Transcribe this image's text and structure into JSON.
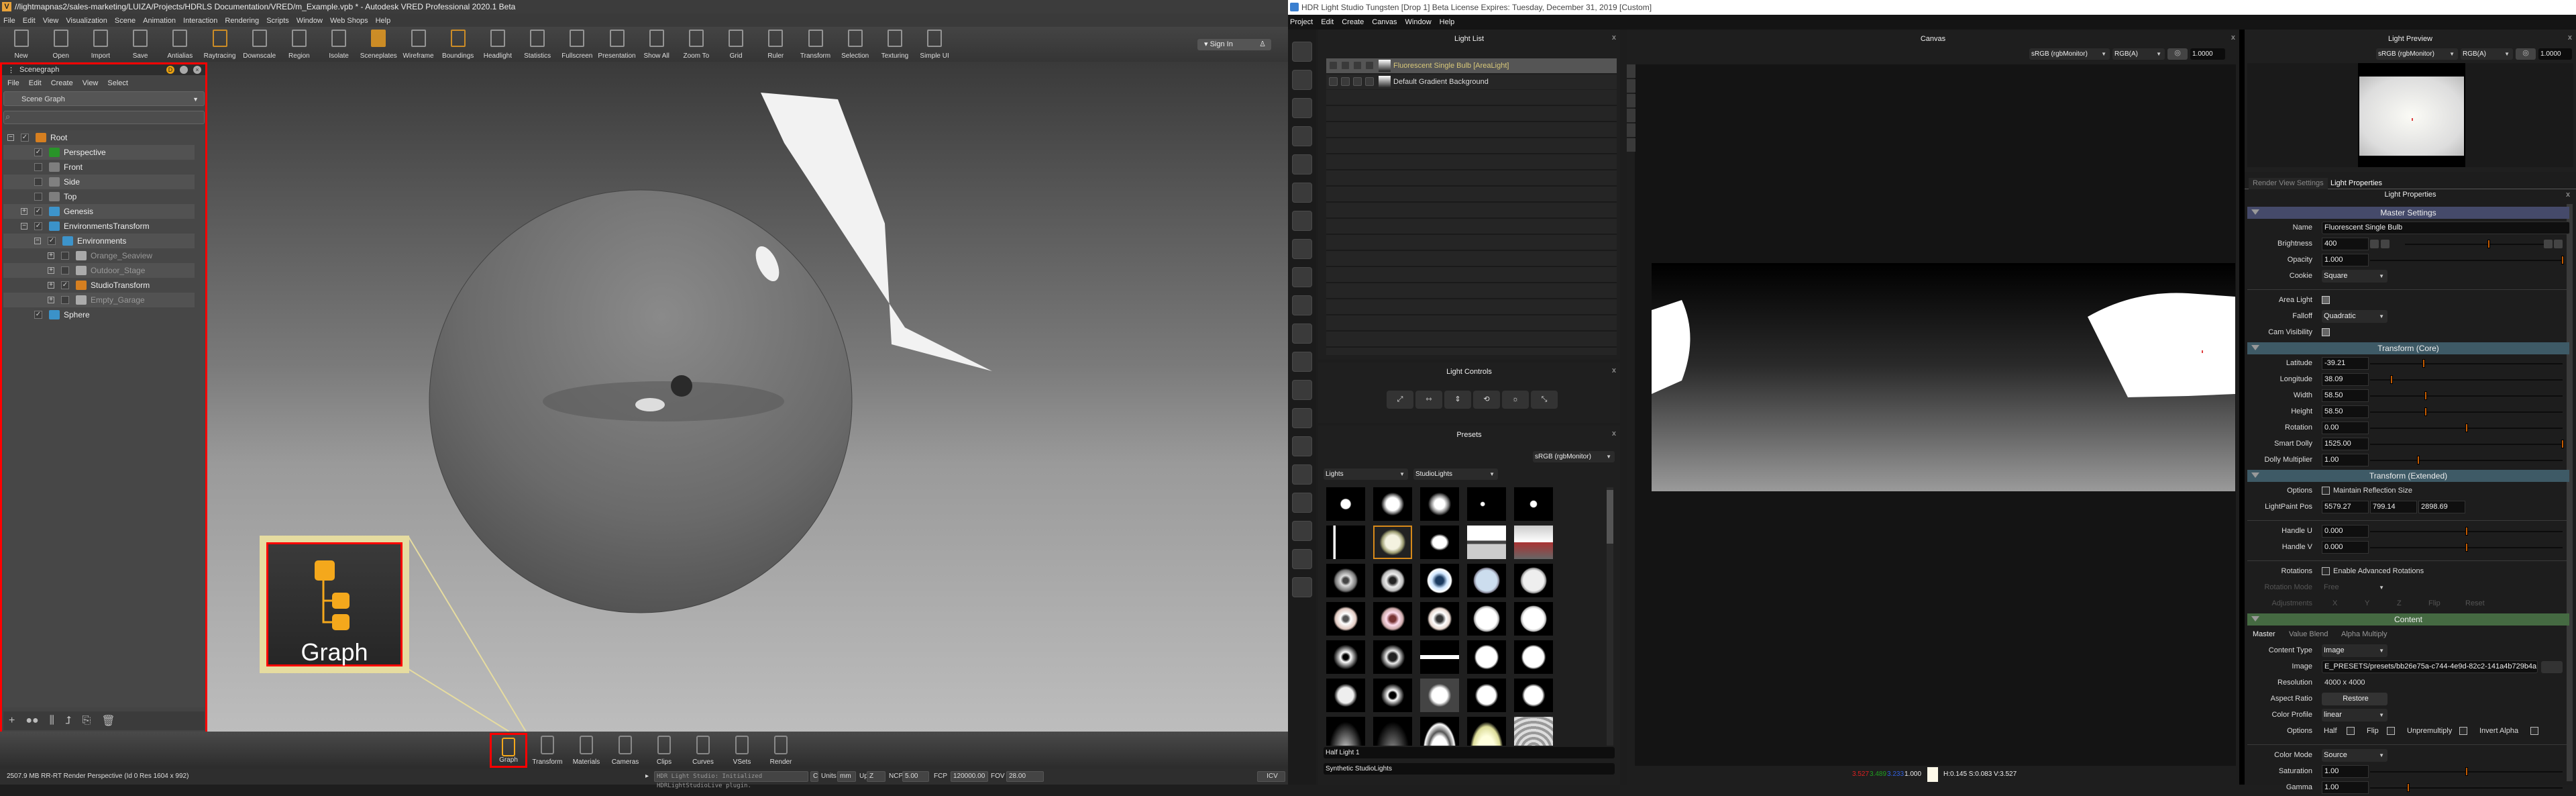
{
  "vred": {
    "title": "//lightmapnas2/sales-marketing/LUIZA/Projects/HDRLS Documentation/VRED/m_Example.vpb * - Autodesk VRED Professional 2020.1 Beta",
    "menu": [
      "File",
      "Edit",
      "View",
      "Visualization",
      "Scene",
      "Animation",
      "Interaction",
      "Rendering",
      "Scripts",
      "Window",
      "Web Shops",
      "Help"
    ],
    "toolbar": [
      "New",
      "Open",
      "Import",
      "Save",
      "Antialias",
      "Raytracing",
      "Downscale",
      "Region",
      "Isolate",
      "Sceneplates",
      "Wireframe",
      "Boundings",
      "Headlight",
      "Statistics",
      "Fullscreen",
      "Presentation",
      "Show All",
      "Zoom To",
      "Grid",
      "Ruler",
      "Transform",
      "Selection",
      "Texturing",
      "Simple UI"
    ],
    "sign_in": "Sign In",
    "scenegraph": {
      "title": "Scenegraph",
      "menu": [
        "File",
        "Edit",
        "Create",
        "View",
        "Select"
      ],
      "view_select": "Scene Graph",
      "search_placeholder": "",
      "tree": [
        {
          "label": "Root",
          "level": 0,
          "expander": "-",
          "checked": true,
          "icon": "transform-node-icon"
        },
        {
          "label": "Perspective",
          "level": 1,
          "expander": "",
          "checked": true,
          "icon": "camera-icon"
        },
        {
          "label": "Front",
          "level": 1,
          "expander": "",
          "checked": false,
          "icon": "cube-icon"
        },
        {
          "label": "Side",
          "level": 1,
          "expander": "",
          "checked": false,
          "icon": "cube-icon"
        },
        {
          "label": "Top",
          "level": 1,
          "expander": "",
          "checked": false,
          "icon": "cube-icon"
        },
        {
          "label": "Genesis",
          "level": 1,
          "expander": "+",
          "checked": true,
          "icon": "transform-icon"
        },
        {
          "label": "EnvironmentsTransform",
          "level": 1,
          "expander": "-",
          "checked": true,
          "icon": "transform-icon"
        },
        {
          "label": "Environments",
          "level": 2,
          "expander": "-",
          "checked": true,
          "icon": "environment-switch-icon"
        },
        {
          "label": "Orange_Seaview",
          "level": 3,
          "expander": "+",
          "checked": false,
          "icon": "environment-icon",
          "dimmed": true
        },
        {
          "label": "Outdoor_Stage",
          "level": 3,
          "expander": "+",
          "checked": false,
          "icon": "environment-icon",
          "dimmed": true
        },
        {
          "label": "StudioTransform",
          "level": 3,
          "expander": "+",
          "checked": true,
          "icon": "transform-node-icon"
        },
        {
          "label": "Empty_Garage",
          "level": 3,
          "expander": "+",
          "checked": false,
          "icon": "environment-icon",
          "dimmed": true
        },
        {
          "label": "Sphere",
          "level": 1,
          "expander": "",
          "checked": true,
          "icon": "geometry-icon"
        }
      ]
    },
    "callout_label": "Graph",
    "modules": [
      "Graph",
      "Transform",
      "Materials",
      "Cameras",
      "Clips",
      "Curves",
      "VSets",
      "Render"
    ],
    "status": {
      "text": "2507.9 MB  RR-RT  Render Perspective (Id 0 Res 1604 x 992)",
      "console": "HDR Light Studio: Initialized HDRLightStudioLive plugin.",
      "c_button": "C",
      "units_label": "Units",
      "units": "mm",
      "up_label": "Up",
      "up": "Z",
      "ncp_label": "NCP",
      "ncp": "5.00",
      "fcp_label": "FCP",
      "fcp": "120000.00",
      "fov_label": "FOV",
      "fov": "28.00",
      "icv": "ICV"
    }
  },
  "hdr": {
    "title": "HDR Light Studio Tungsten [Drop 1] Beta License Expires: Tuesday, December 31, 2019  [Custom]",
    "menu": [
      "Project",
      "Edit",
      "Create",
      "Canvas",
      "Window",
      "Help"
    ],
    "light_list": {
      "title": "Light List",
      "items": [
        {
          "label": "Fluorescent Single Bulb [AreaLight]",
          "selected": true
        },
        {
          "label": "Default Gradient Background",
          "selected": false
        }
      ]
    },
    "light_controls": {
      "title": "Light Controls"
    },
    "presets": {
      "title": "Presets",
      "color_space": "sRGB (rgbMonitor)",
      "category": "Lights",
      "subcategory": "StudioLights",
      "selected_name": "Half Light 1",
      "selected_group": "Synthetic StudioLights"
    },
    "canvas": {
      "title": "Canvas",
      "color_space": "sRGB (rgbMonitor)",
      "channels": "RGB(A)",
      "exposure": "1.0000",
      "readout": {
        "r": "3.527",
        "g": "3.489",
        "b": "3.233",
        "a": "1.000",
        "hsv": "H:0.145 S:0.083 V:3.527"
      },
      "colors": {
        "r": "#e02020",
        "g": "#20a020",
        "b": "#3060e0"
      }
    },
    "light_preview": {
      "title": "Light Preview",
      "color_space": "sRGB (rgbMonitor)",
      "channels": "RGB(A)",
      "exposure": "1.0000"
    },
    "tabs": [
      "Render View Settings",
      "Light Properties"
    ],
    "properties": {
      "title": "Light Properties",
      "rows": [
        {
          "type": "header",
          "text": "Master Settings",
          "color": "#454a6a"
        },
        {
          "type": "text",
          "label": "Name",
          "value": "Fluorescent Single Bulb"
        },
        {
          "type": "slider",
          "label": "Brightness",
          "value": "400",
          "fraction": 0.58,
          "buttons": true
        },
        {
          "type": "slider",
          "label": "Opacity",
          "value": "1.000",
          "fraction": 1.0
        },
        {
          "type": "select",
          "label": "Cookie",
          "value": "Square"
        },
        {
          "type": "divider"
        },
        {
          "type": "check",
          "label": "Area Light",
          "checked": true
        },
        {
          "type": "select",
          "label": "Falloff",
          "value": "Quadratic"
        },
        {
          "type": "check",
          "label": "Cam Visibility",
          "checked": true
        },
        {
          "type": "header",
          "text": "Transform (Core)",
          "color": "#3e5a66"
        },
        {
          "type": "slider",
          "label": "Latitude",
          "value": "-39.21",
          "fraction": 0.28
        },
        {
          "type": "slider",
          "label": "Longitude",
          "value": "38.09",
          "fraction": 0.11
        },
        {
          "type": "slider",
          "label": "Width",
          "value": "58.50",
          "fraction": 0.29
        },
        {
          "type": "slider",
          "label": "Height",
          "value": "58.50",
          "fraction": 0.29
        },
        {
          "type": "slider",
          "label": "Rotation",
          "value": "0.00",
          "fraction": 0.5
        },
        {
          "type": "slider",
          "label": "Smart Dolly",
          "value": "1525.00",
          "fraction": 1.0
        },
        {
          "type": "slider",
          "label": "Dolly Multiplier",
          "value": "1.00",
          "fraction": 0.25
        },
        {
          "type": "header",
          "text": "Transform (Extended)",
          "color": "#3e5a66"
        },
        {
          "type": "check",
          "label": "Options",
          "checked": false,
          "text": "Maintain Reflection Size"
        },
        {
          "type": "triple",
          "label": "LightPaint Pos",
          "values": [
            "5579.27",
            "799.14",
            "2898.69"
          ]
        },
        {
          "type": "divider"
        },
        {
          "type": "slider",
          "label": "Handle U",
          "value": "0.000",
          "fraction": 0.5
        },
        {
          "type": "slider",
          "label": "Handle V",
          "value": "0.000",
          "fraction": 0.5
        },
        {
          "type": "divider"
        },
        {
          "type": "check",
          "label": "Rotations",
          "checked": false,
          "text": "Enable Advanced Rotations"
        },
        {
          "type": "select",
          "label": "Rotation Mode",
          "value": "Free",
          "disabled": true
        },
        {
          "type": "adjust",
          "label": "Adjustments",
          "items": [
            "X",
            "Y",
            "Z",
            "Flip",
            "Reset"
          ],
          "disabled": true
        },
        {
          "type": "header",
          "text": "Content",
          "color": "#456a42"
        },
        {
          "type": "subtabs",
          "items": [
            "Master",
            "Value Blend",
            "Alpha Multiply"
          ]
        },
        {
          "type": "select",
          "label": "Content Type",
          "value": "Image"
        },
        {
          "type": "file",
          "label": "Image",
          "value": "E_PRESETS/presets/bb26e75a-c744-4e9d-82c2-141a4b729b4a.tx"
        },
        {
          "type": "static",
          "label": "Resolution",
          "value": "4000 x 4000"
        },
        {
          "type": "button",
          "label": "Aspect Ratio",
          "value": "Restore"
        },
        {
          "type": "select",
          "label": "Color Profile",
          "value": "linear"
        },
        {
          "type": "checks",
          "label": "Options",
          "items": [
            {
              "text": "Half",
              "checked": false
            },
            {
              "text": "Flip",
              "checked": false
            },
            {
              "text": "Unpremultiply",
              "checked": false
            },
            {
              "text": "Invert Alpha",
              "checked": false
            }
          ]
        },
        {
          "type": "divider"
        },
        {
          "type": "select",
          "label": "Color Mode",
          "value": "Source"
        },
        {
          "type": "slider",
          "label": "Saturation",
          "value": "1.00",
          "fraction": 0.5
        },
        {
          "type": "slider",
          "label": "Gamma",
          "value": "1.00",
          "fraction": 0.2
        }
      ]
    }
  }
}
